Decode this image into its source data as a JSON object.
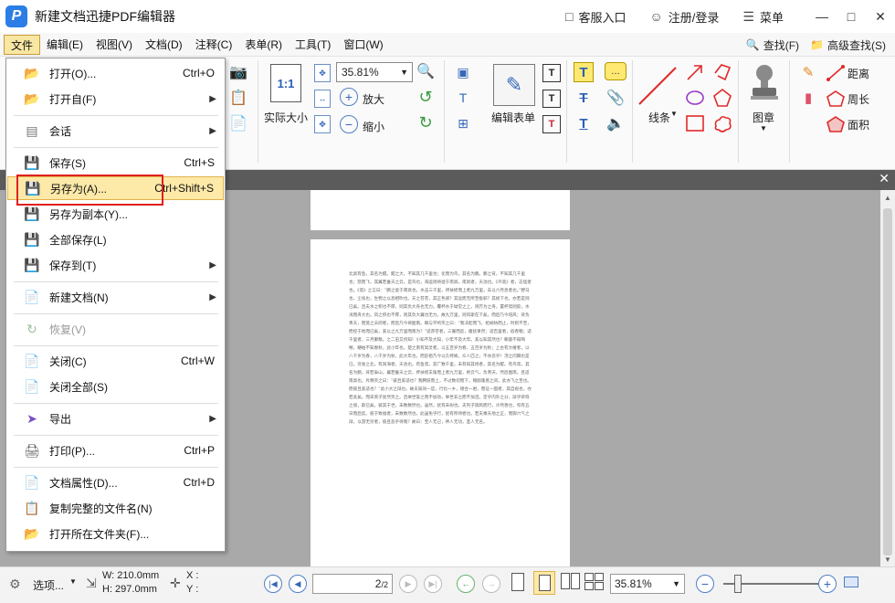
{
  "title_bar": {
    "app_title": "新建文档迅捷PDF编辑器",
    "customer_service": "客服入口",
    "register_login": "注册/登录",
    "menu": "菜单"
  },
  "menubar": {
    "items": [
      "文件",
      "编辑(E)",
      "视图(V)",
      "文档(D)",
      "注释(C)",
      "表单(R)",
      "工具(T)",
      "窗口(W)"
    ],
    "find": "查找(F)",
    "advanced_find": "高级查找(S)"
  },
  "toolbar": {
    "zoom_value": "35.81%",
    "actual_size": "实际大小",
    "actual_size_glyph": "1:1",
    "zoom_in": "放大",
    "zoom_out": "缩小",
    "edit_form": "编辑表单",
    "line": "线条",
    "stamp": "图章",
    "distance": "距离",
    "perimeter": "周长",
    "area": "面积"
  },
  "file_menu": {
    "items": [
      {
        "label": "打开(O)...",
        "shortcut": "Ctrl+O",
        "submenu": false
      },
      {
        "label": "打开自(F)",
        "shortcut": "",
        "submenu": true
      },
      {
        "label": "会话",
        "shortcut": "",
        "submenu": true
      },
      {
        "label": "保存(S)",
        "shortcut": "Ctrl+S",
        "submenu": false
      },
      {
        "label": "另存为(A)...",
        "shortcut": "Ctrl+Shift+S",
        "submenu": false
      },
      {
        "label": "另存为副本(Y)...",
        "shortcut": "",
        "submenu": false
      },
      {
        "label": "全部保存(L)",
        "shortcut": "",
        "submenu": false
      },
      {
        "label": "保存到(T)",
        "shortcut": "",
        "submenu": true
      },
      {
        "label": "新建文档(N)",
        "shortcut": "",
        "submenu": true
      },
      {
        "label": "恢复(V)",
        "shortcut": "",
        "submenu": false
      },
      {
        "label": "关闭(C)",
        "shortcut": "Ctrl+W",
        "submenu": false
      },
      {
        "label": "关闭全部(S)",
        "shortcut": "",
        "submenu": false
      },
      {
        "label": "导出",
        "shortcut": "",
        "submenu": true
      },
      {
        "label": "打印(P)...",
        "shortcut": "Ctrl+P",
        "submenu": false
      },
      {
        "label": "文档属性(D)...",
        "shortcut": "Ctrl+D",
        "submenu": false
      },
      {
        "label": "复制完整的文件名(N)",
        "shortcut": "",
        "submenu": false
      },
      {
        "label": "打开所在文件夹(F)...",
        "shortcut": "",
        "submenu": false
      }
    ],
    "highlighted_item": "另存为(A)...",
    "disabled_item": "恢复(V)"
  },
  "document": {
    "body_text": "北冥有鱼，其名为鲲。鲲之大，不知其几千里也；化而为鸟，其名为鹏。鹏之背，不知其几千里也；怒而飞，其翼若垂天之云。是鸟也，海运则将徙于南冥。南冥者，天池也。《齐谐》者，志怪者也。《谐》之言曰：“鹏之徙于南冥也，水击三千里，抟扶摇而上者九万里，去以六月息者也。”野马也，尘埃也，生物之以息相吹也。天之苍苍，其正色邪？其远而无所至极邪？其视下也，亦若是则已矣。且夫水之积也不厚，则其负大舟也无力。覆杯水于坳堂之上，则芥为之舟，置杯焉则胶，水浅而舟大也。风之积也不厚，则其负大翼也无力。故九万里，则风斯在下矣，而后乃今培风；背负青天，而莫之夭阏者，而后乃今将图南。蜩与学鸠笑之曰：“我决起而飞，抢榆枋而止，时则不至，而控于地而已矣，奚以之九万里而南为？”适莽苍者，三餐而反，腹犹果然；适百里者，宿舂粮；适千里者，三月聚粮。之二虫又何知！小知不及大知，小年不及大年。奚以知其然也？朝菌不知晦朔，蟪蛄不知春秋，此小年也。楚之南有冥灵者，以五百岁为春，五百岁为秋；上古有大椿者，以八千岁为春，八千岁为秋，此大年也。而彭祖乃今以久特闻，众人匹之，不亦悲乎！汤之问棘也是已。穷发之北，有冥海者，天池也。有鱼焉，其广数千里，未有知其修者，其名为鲲。有鸟焉，其名为鹏，背若泰山，翼若垂天之云，抟扶摇羊角而上者九万里，绝云气，负青天，然后图南，且适南冥也。斥鴳笑之曰：“彼且奚适也？我腾跃而上，不过数仞而下，翱翔蓬蒿之间，此亦飞之至也。而彼且奚适也？”此小大之辩也。故夫知效一官，行比一乡，德合一君，而征一国者，其自视也，亦若此矣。而宋荣子犹然笑之。且举世誉之而不加劝，举世非之而不加沮，定乎内外之分，辩乎荣辱之境，斯已矣。彼其于世，未数数然也。虽然，犹有未树也。夫列子御风而行，泠然善也，旬有五日而后反。彼于致福者，未数数然也。此虽免乎行，犹有所待者也。若夫乘天地之正，而御六气之辩，以游无穷者，彼且恶乎待哉？故曰：至人无己，神人无功，圣人无名。"
  },
  "statusbar": {
    "options": "选项...",
    "width": "W: 210.0mm",
    "height": "H: 297.0mm",
    "x": "X :",
    "y": "Y :",
    "page": "2",
    "page_total": "/2",
    "zoom": "35.81%"
  },
  "colors": {
    "highlight_bg": "#fde9a8",
    "highlight_border": "#e0b24a",
    "red_annotation": "#e02020",
    "doc_bg": "#a9a9a9"
  }
}
